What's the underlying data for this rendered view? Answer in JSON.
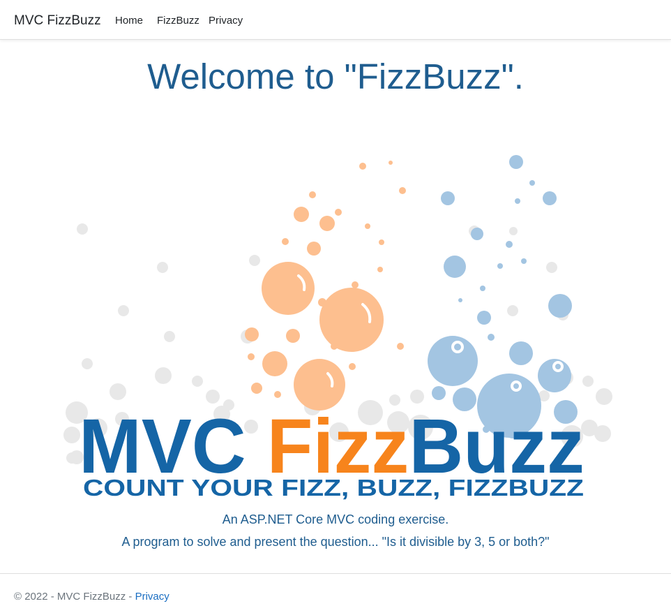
{
  "nav": {
    "brand": "MVC FizzBuzz",
    "links": [
      "Home",
      "FizzBuzz",
      "Privacy"
    ]
  },
  "main": {
    "heading": "Welcome to \"FizzBuzz\".",
    "logo": {
      "word_mvc": "MVC",
      "word_fizz": "Fizz",
      "word_buzz": "Buzz",
      "tagline": "COUNT YOUR FIZZ, BUZZ, FIZZBUZZ",
      "colors": {
        "blue": "#1565a6",
        "orange": "#f7841c",
        "orange_bubble": "#fdbf8f",
        "blue_bubble": "#97bedd",
        "grey_bubble": "#e6e6e6"
      }
    },
    "lines": [
      "An ASP.NET Core MVC coding exercise.",
      "A program to solve and present the question... \"Is it divisible by 3, 5 or both?\""
    ]
  },
  "footer": {
    "text": "© 2022 - MVC FizzBuzz - ",
    "link": "Privacy"
  }
}
